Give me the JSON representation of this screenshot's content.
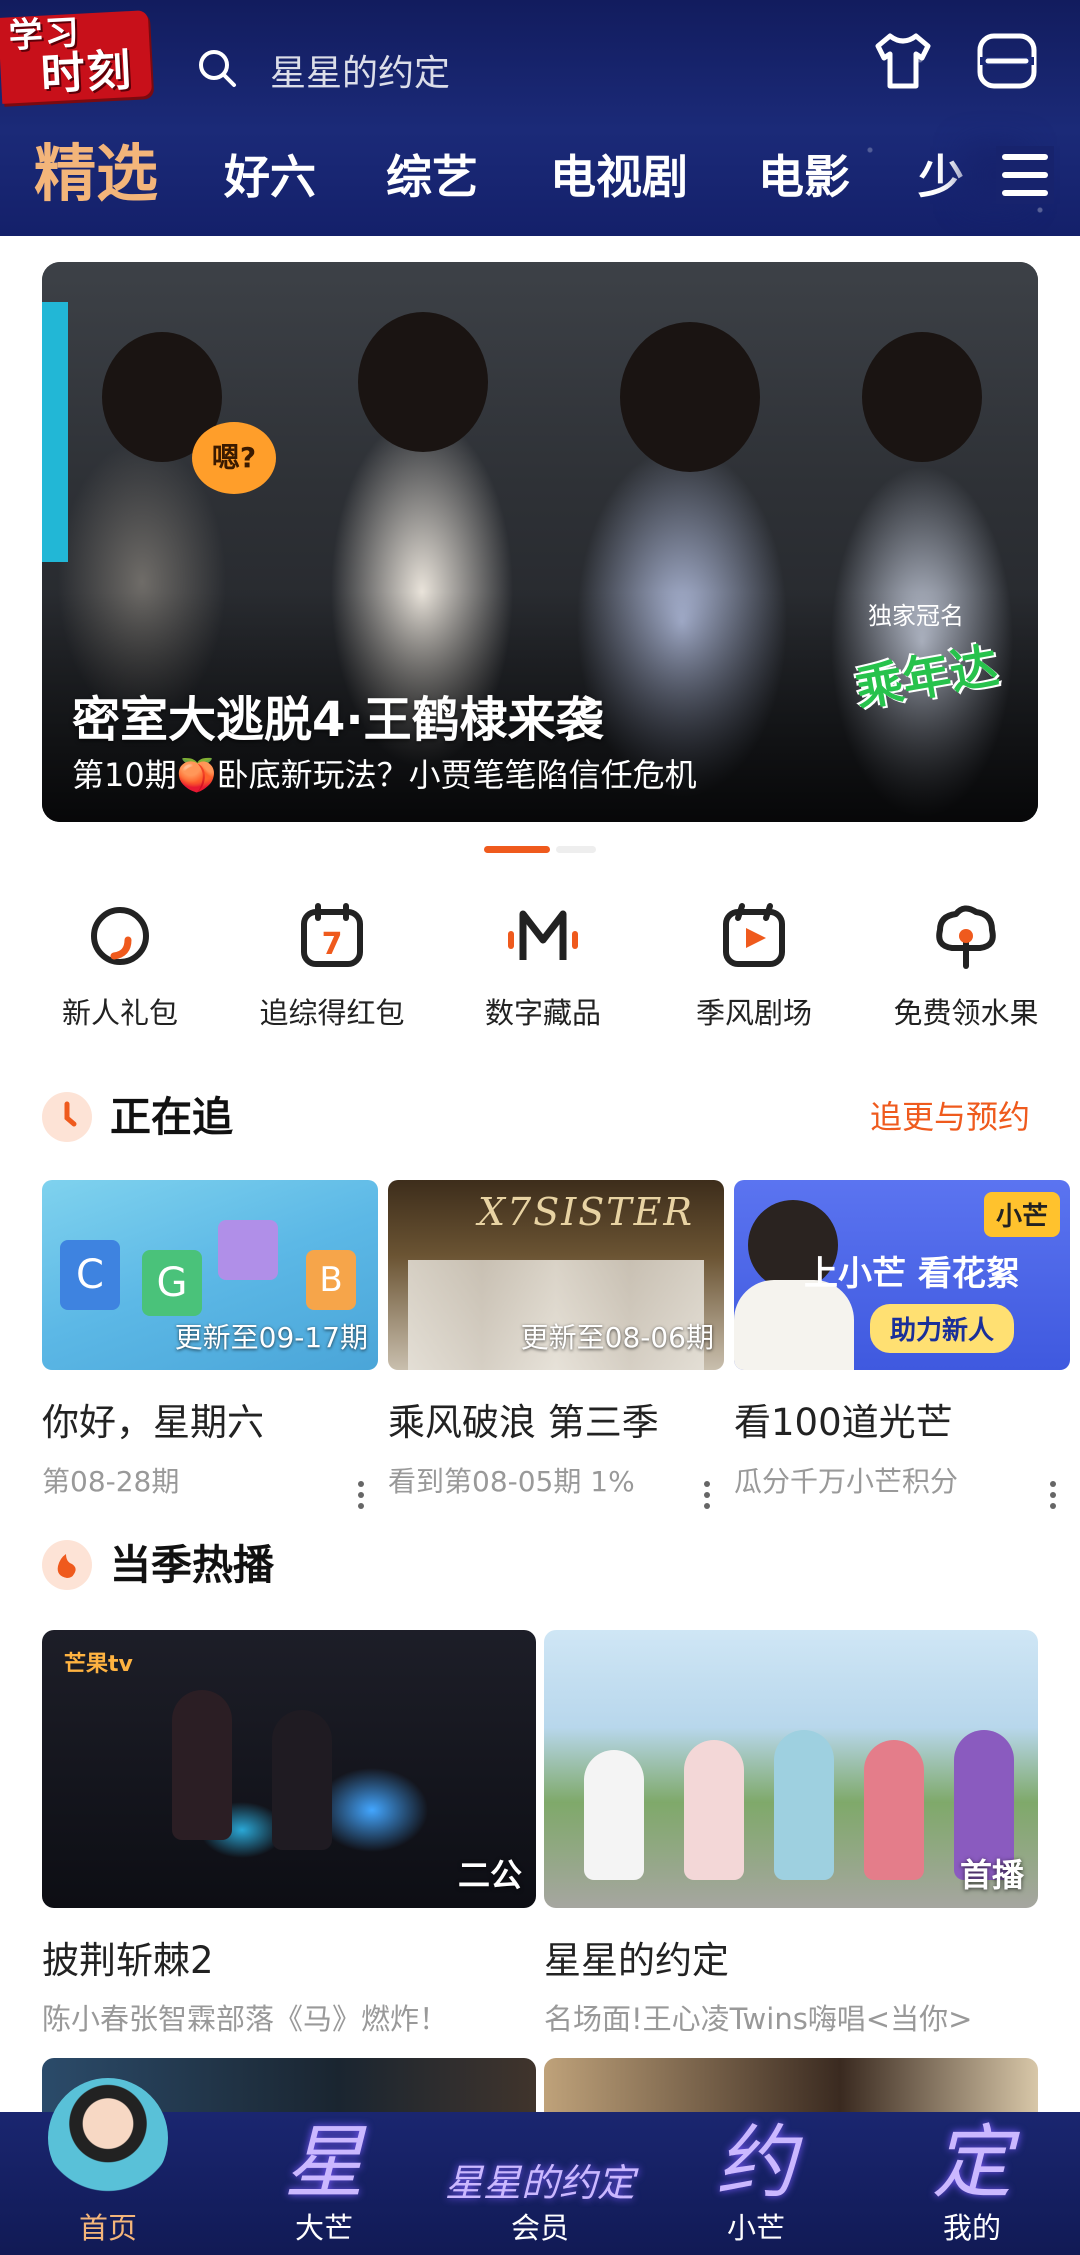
{
  "header": {
    "logo_line1": "学习",
    "logo_line2": "时刻",
    "search_placeholder": "星星的约定",
    "icons": [
      "search-icon",
      "tshirt-icon",
      "scan-icon",
      "menu-icon"
    ],
    "tabs": [
      "精选",
      "好六",
      "综艺",
      "电视剧",
      "电影",
      "少"
    ],
    "active_tab": "精选"
  },
  "banner": {
    "title": "密室大逃脱4·王鹤棣来袭",
    "subtitle": "第10期🍑卧底新玩法？小贾笔笔陷信任危机",
    "bubble": "嗯?",
    "sponsor_label": "独家冠名",
    "sponsor_logo": "乘年达",
    "active_page": 1,
    "page_count": 2
  },
  "quick_actions": [
    {
      "label": "新人礼包",
      "icon": "gift-ring-icon"
    },
    {
      "label": "追综得红包",
      "icon": "calendar-7-icon"
    },
    {
      "label": "数字藏品",
      "icon": "m-logo-icon"
    },
    {
      "label": "季风剧场",
      "icon": "play-calendar-icon"
    },
    {
      "label": "免费领水果",
      "icon": "fruit-tree-icon"
    }
  ],
  "following": {
    "title": "正在追",
    "more": "追更与预约",
    "items": [
      {
        "name": "你好，星期六",
        "episode": "更新至09-17期",
        "meta": "第08-28期"
      },
      {
        "name": "乘风破浪 第三季",
        "episode": "更新至08-06期",
        "meta": "看到第08-05期 1%",
        "thumb_text": "X7SISTER"
      },
      {
        "name": "看100道光芒",
        "episode": "",
        "meta": "瓜分千万小芒积分",
        "badge": "小芒",
        "thumb_title": "上小芒 看花絮",
        "thumb_pill": "助力新人"
      }
    ]
  },
  "hot": {
    "title": "当季热播",
    "items": [
      {
        "name": "披荆斩棘2",
        "tag": "二公",
        "meta": "陈小春张智霖部落《马》燃炸！",
        "watermark": "芒果tv"
      },
      {
        "name": "星星的约定",
        "tag": "首播",
        "meta": "名场面!王心凌Twins嗨唱<当你>"
      }
    ]
  },
  "bottom_nav": [
    {
      "label": "首页",
      "art": "",
      "active": true
    },
    {
      "label": "大芒",
      "art": "星"
    },
    {
      "label": "会员",
      "art": "星星的约定"
    },
    {
      "label": "小芒",
      "art": "约"
    },
    {
      "label": "我的",
      "art": "定"
    }
  ],
  "colors": {
    "header_bg": "#1b2a78",
    "accent": "#ef5a1d",
    "active_tab": "#f3b57a"
  }
}
